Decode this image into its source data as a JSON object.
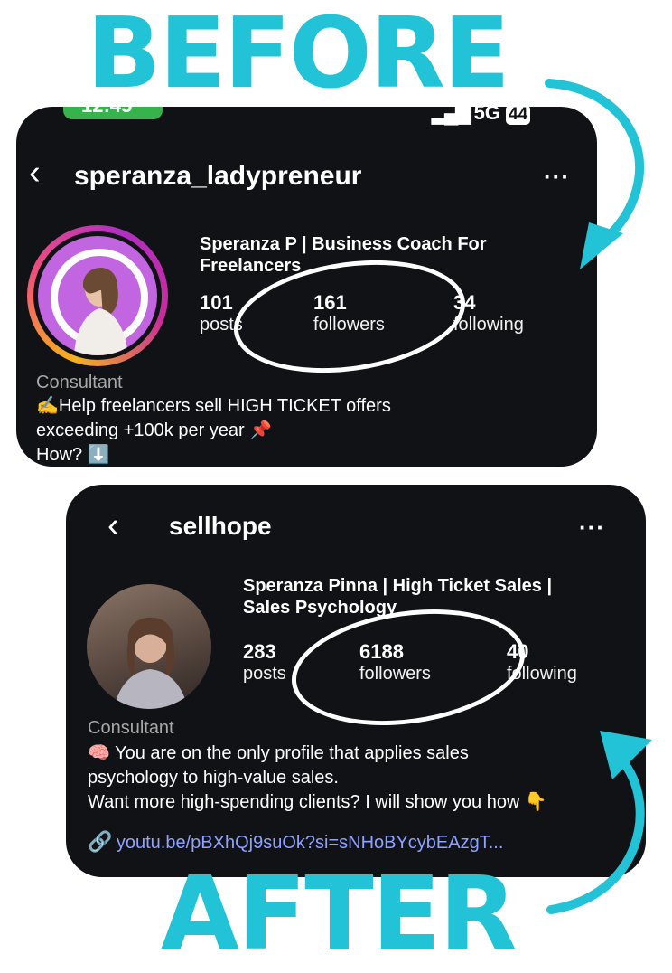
{
  "labels": {
    "before": "BEFORE",
    "after": "AFTER"
  },
  "colors": {
    "accent": "#22c3d6",
    "card_bg": "#111216",
    "link": "#8ea2ff",
    "status_green": "#36b34a"
  },
  "before": {
    "status": {
      "time": "12:45",
      "network": "5G",
      "battery": "44"
    },
    "username": "speranza_ladypreneur",
    "display_name_line1": "Speranza P | Business Coach For",
    "display_name_line2": "Freelancers",
    "stats": {
      "posts": {
        "value": "101",
        "label": "posts"
      },
      "followers": {
        "value": "161",
        "label": "followers"
      },
      "following": {
        "value": "34",
        "label": "following"
      }
    },
    "category": "Consultant",
    "bio_line1": "✍️Help freelancers sell HIGH TICKET offers",
    "bio_line2": "exceeding +100k per year 📌",
    "bio_line3": "How? ⬇️"
  },
  "after": {
    "username": "sellhope",
    "display_name_line1": "Speranza Pinna | High Ticket Sales |",
    "display_name_line2": "Sales Psychology",
    "stats": {
      "posts": {
        "value": "283",
        "label": "posts"
      },
      "followers": {
        "value": "6188",
        "label": "followers"
      },
      "following": {
        "value": "40",
        "label": "following"
      }
    },
    "category": "Consultant",
    "bio_line1": "🧠 You are on the only profile that applies sales",
    "bio_line2": "psychology to high-value sales.",
    "bio_line3": "Want more high-spending clients? I will show you how 👇",
    "link": "youtu.be/pBXhQj9suOk?si=sNHoBYcybEAzgT..."
  }
}
